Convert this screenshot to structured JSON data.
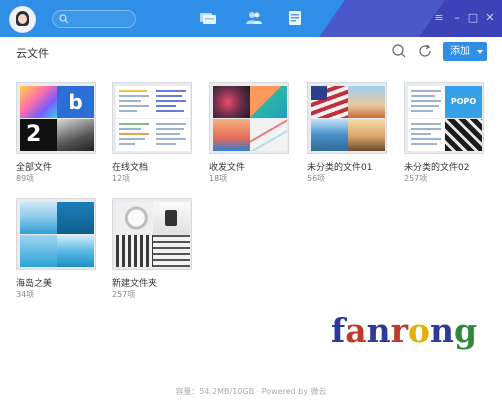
{
  "topbar": {
    "search_placeholder": ""
  },
  "header": {
    "title": "云文件",
    "add_label": "添加"
  },
  "folders": [
    {
      "name": "全部文件",
      "count": "89项"
    },
    {
      "name": "在线文档",
      "count": "12项"
    },
    {
      "name": "收发文件",
      "count": "18项"
    },
    {
      "name": "未分类的文件01",
      "count": "56项"
    },
    {
      "name": "未分类的文件02",
      "count": "257项"
    },
    {
      "name": "海岛之美",
      "count": "34项"
    },
    {
      "name": "新建文件夹",
      "count": "257项"
    }
  ],
  "thumb_text": {
    "b_letter": "b",
    "two_digit": "2",
    "popo": "POPO"
  },
  "watermark": {
    "letters": [
      "f",
      "a",
      "n",
      "r",
      "o",
      "n",
      "g"
    ],
    "colors": [
      "#2e3a9a",
      "#c0392b",
      "#2e3a9a",
      "#c0392b",
      "#e0b100",
      "#2e3a9a",
      "#2e8a3a"
    ]
  },
  "footer": {
    "text": "容量：54.2MB/10GB · Powered by 微云"
  },
  "icons": [
    "search-icon",
    "files-icon",
    "contacts-icon",
    "notes-icon",
    "menu-icon",
    "minimize-icon",
    "maximize-icon",
    "close-icon",
    "refresh-icon",
    "dropdown-caret-icon"
  ]
}
